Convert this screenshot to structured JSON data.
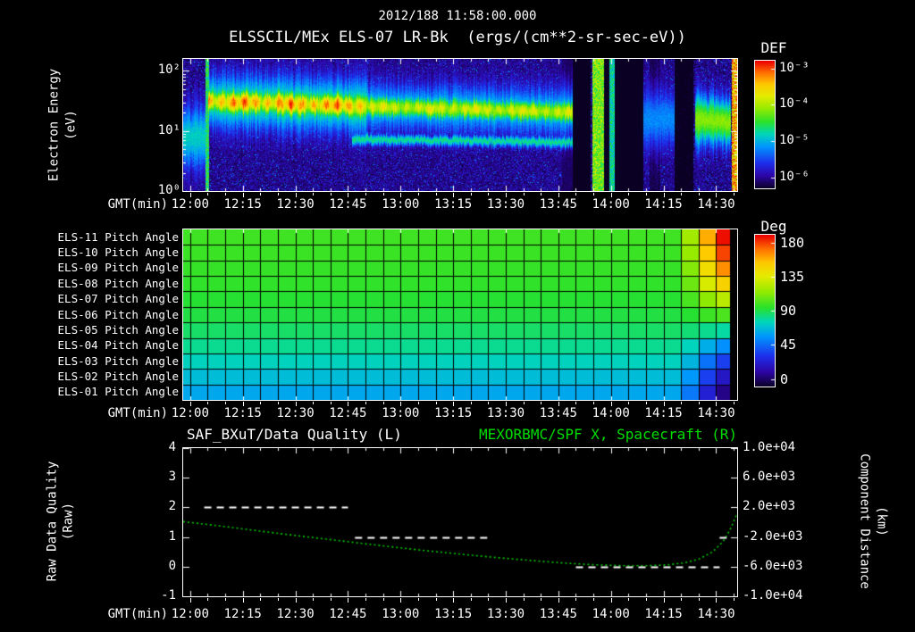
{
  "colors": {
    "background": "#000000",
    "text": "#ffffff",
    "spacecraft_green": "#00dd00",
    "quality_white": "#ffffff"
  },
  "header": {
    "datetime": "2012/188 11:58:00.000",
    "plot_title": "ELSSCIL/MEx ELS-07 LR-Bk  (ergs/(cm**2-sr-sec-eV))"
  },
  "time_axis": {
    "label": "GMT(min)",
    "start_time": "11:58",
    "minutes_span": 158,
    "tick_minutes": [
      2,
      17,
      32,
      47,
      62,
      77,
      92,
      107,
      122,
      137,
      152
    ],
    "tick_labels": [
      "12:00",
      "12:15",
      "12:30",
      "12:45",
      "13:00",
      "13:15",
      "13:30",
      "13:45",
      "14:00",
      "14:15",
      "14:30"
    ],
    "minor_tick_step_minutes": 5
  },
  "spectrogram_panel": {
    "ylabel_lines": [
      "Electron Energy",
      "(eV)"
    ],
    "ytick_labels": [
      "10²",
      "10¹",
      "10⁰"
    ],
    "ytick_decades": [
      2,
      1,
      0
    ],
    "colorbar_title": "DEF",
    "colorbar_tick_labels": [
      "10⁻³",
      "10⁻⁴",
      "10⁻⁵",
      "10⁻⁶"
    ]
  },
  "pitch_panel": {
    "row_labels": [
      "ELS-11 Pitch Angle",
      "ELS-10 Pitch Angle",
      "ELS-09 Pitch Angle",
      "ELS-08 Pitch Angle",
      "ELS-07 Pitch Angle",
      "ELS-06 Pitch Angle",
      "ELS-05 Pitch Angle",
      "ELS-04 Pitch Angle",
      "ELS-03 Pitch Angle",
      "ELS-02 Pitch Angle",
      "ELS-01 Pitch Angle"
    ],
    "colorbar_title": "Deg",
    "colorbar_tick_labels": [
      "180",
      "135",
      "90",
      "45",
      "0"
    ]
  },
  "bottom_panel": {
    "left_title": "SAF_BXuT/Data Quality (L)",
    "right_title": "MEXORBMC/SPF X, Spacecraft (R)",
    "left_axis_lines": [
      "Raw Data Quality",
      "(Raw)"
    ],
    "right_axis_lines": [
      "Component Distance",
      "(km)"
    ],
    "left_tick_labels": [
      "4",
      "3",
      "2",
      "1",
      "0",
      "-1"
    ],
    "right_tick_labels": [
      "1.0e+04",
      "6.0e+03",
      "2.0e+03",
      "-2.0e+03",
      "-6.0e+03",
      "-1.0e+04"
    ]
  },
  "chart_data": [
    {
      "type": "heatmap",
      "name": "electron-energy-spectrogram",
      "title": "ELSSCIL/MEx ELS-07 LR-Bk",
      "units": "ergs/(cm**2-sr-sec-eV)",
      "x_axis": {
        "label": "GMT(min)",
        "start": "11:58",
        "span_minutes": 158
      },
      "y_axis": {
        "label": "Electron Energy (eV)",
        "scale": "log",
        "min": 1,
        "max": 158
      },
      "color_axis": {
        "label": "DEF",
        "scale": "log",
        "min": 1e-06,
        "max": 0.001
      },
      "features": {
        "t_max": 158,
        "log_e_max": 2.2,
        "background": {
          "base": -6.05,
          "noise": 0.55
        },
        "bands": [
          {
            "t": [
              0,
              7
            ],
            "center": [
              0.9,
              0.9
            ],
            "width": 0.5,
            "amp": 1.15
          },
          {
            "t": [
              7,
              52
            ],
            "center": [
              1.5,
              1.42
            ],
            "width": 0.45,
            "amp": 1.35
          },
          {
            "t": [
              7,
              52
            ],
            "center": [
              1.5,
              1.42
            ],
            "width": 0.21,
            "amp": 2.35,
            "flicker": 0.55
          },
          {
            "t": [
              50,
              111
            ],
            "center": [
              1.42,
              1.32
            ],
            "width": 0.4,
            "amp": 1.1
          },
          {
            "t": [
              50,
              111
            ],
            "center": [
              1.42,
              1.32
            ],
            "width": 0.19,
            "amp": 1.95,
            "flicker": 0.3
          },
          {
            "t": [
              48,
              111
            ],
            "center": [
              0.87,
              0.82
            ],
            "width": 0.09,
            "amp": 1.3
          },
          {
            "t": [
              131,
              140
            ],
            "center": [
              1.2,
              1.2
            ],
            "width": 0.5,
            "amp": 0.85
          },
          {
            "t": [
              146,
              156
            ],
            "center": [
              1.2,
              1.15
            ],
            "width": 0.42,
            "amp": 1.75
          }
        ],
        "bright_columns": [
          {
            "t": [
              6.3,
              7.3
            ],
            "amp": 1.5
          },
          {
            "t": [
              116.5,
              120
            ],
            "amp": 1.85
          },
          {
            "t": [
              121.5,
              123
            ],
            "amp": 1.35
          },
          {
            "t": [
              156.3,
              158
            ],
            "amp": 2.55
          }
        ],
        "dark_columns": [
          {
            "t": [
              108,
              116
            ],
            "level": 0.25
          },
          {
            "t": [
              120,
              121.5
            ],
            "level": 0.35
          },
          {
            "t": [
              123,
              131
            ],
            "level": 0.2
          },
          {
            "t": [
              133,
              136
            ],
            "level": 0.35
          },
          {
            "t": [
              140,
              145.5
            ],
            "level": 0.45
          }
        ]
      }
    },
    {
      "type": "heatmap",
      "name": "pitch-angle-rows",
      "color_axis": {
        "label": "Deg",
        "min": 0,
        "max": 180
      },
      "t_max": 158,
      "grid_step_minutes": 5,
      "rows_deg": [
        98,
        97,
        96,
        95,
        93,
        91,
        87,
        82,
        76,
        70,
        64
      ],
      "edge_rows_deg": [
        178,
        170,
        158,
        143,
        121,
        100,
        80,
        58,
        40,
        26,
        14
      ],
      "edge_start_minute": 140,
      "edge_full_minute": 151,
      "blackout_minute": 156
    },
    {
      "type": "line",
      "name": "quality-and-spacecraft-x",
      "x_axis": {
        "label": "GMT(min)",
        "start": "11:58",
        "span_minutes": 158
      },
      "left_axis": {
        "label": "Raw Data Quality (Raw)",
        "min": -1,
        "max": 4,
        "ticks": [
          4,
          3,
          2,
          1,
          0,
          -1
        ]
      },
      "right_axis": {
        "label": "Component Distance (km)",
        "min": -10000,
        "max": 10000,
        "ticks": [
          10000,
          6000,
          2000,
          -2000,
          -6000,
          -10000
        ]
      },
      "series": [
        {
          "name": "SAF_BXuT/Data Quality (L)",
          "axis": "left",
          "style": "dashed",
          "color": "#ffffff",
          "segments": [
            {
              "y": 2,
              "t": [
                6,
                47
              ]
            },
            {
              "y": 1,
              "t": [
                49,
                87
              ]
            },
            {
              "y": 0,
              "t": [
                112,
                153
              ]
            },
            {
              "y": 1,
              "t": [
                153,
                155
              ]
            }
          ]
        },
        {
          "name": "MEXORBMC/SPF X, Spacecraft (R)",
          "axis": "right",
          "style": "dotted",
          "color": "#00cc00",
          "t": [
            0,
            10,
            20,
            30,
            40,
            50,
            60,
            70,
            80,
            90,
            100,
            110,
            118,
            126,
            132,
            138,
            143,
            147,
            151,
            154,
            156,
            158
          ],
          "x_km": [
            80,
            -480,
            -1080,
            -1680,
            -2240,
            -2800,
            -3360,
            -3880,
            -4360,
            -4800,
            -5200,
            -5560,
            -5760,
            -5880,
            -5880,
            -5760,
            -5480,
            -5000,
            -4000,
            -2600,
            -1000,
            1200
          ]
        }
      ]
    }
  ]
}
